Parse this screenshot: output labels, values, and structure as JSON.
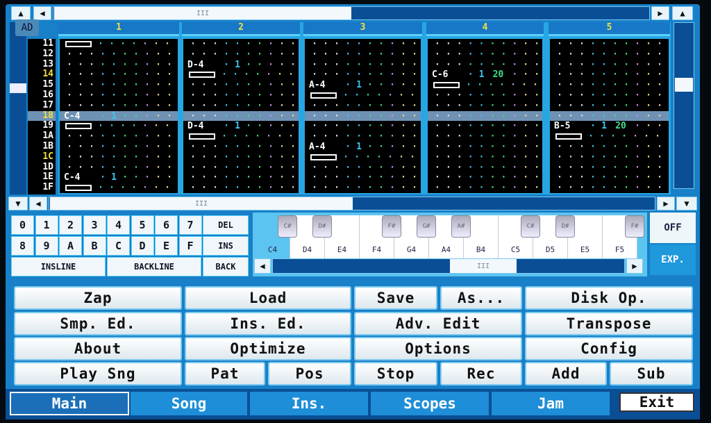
{
  "pattern": {
    "corner_label": "AD",
    "scroll_thumb": "III",
    "channels": [
      "1",
      "2",
      "3",
      "4",
      "5"
    ],
    "rows": [
      "11",
      "12",
      "13",
      "14",
      "15",
      "16",
      "17",
      "18",
      "19",
      "1A",
      "1B",
      "1C",
      "1D",
      "1E",
      "1F"
    ],
    "highlighted_rows": [
      "14",
      "18",
      "1C"
    ],
    "cursor_row": "18",
    "events": [
      [
        {
          "row": "11",
          "off": true
        },
        {
          "row": "18",
          "note": "C-4",
          "ins": "1"
        },
        {
          "row": "19",
          "off": true
        },
        {
          "row": "1E",
          "note": "C-4",
          "ins": "1"
        },
        {
          "row": "1F",
          "off": true
        }
      ],
      [
        {
          "row": "13",
          "note": "D-4",
          "ins": "1"
        },
        {
          "row": "14",
          "off": true
        },
        {
          "row": "19",
          "note": "D-4",
          "ins": "1"
        },
        {
          "row": "1A",
          "off": true
        }
      ],
      [
        {
          "row": "15",
          "note": "A-4",
          "ins": "1"
        },
        {
          "row": "16",
          "off": true
        },
        {
          "row": "1B",
          "note": "A-4",
          "ins": "1"
        },
        {
          "row": "1C",
          "off": true
        }
      ],
      [
        {
          "row": "14",
          "note": "C-6",
          "ins": "1",
          "vol": "20"
        },
        {
          "row": "15",
          "off": true
        }
      ],
      [
        {
          "row": "19",
          "note": "B-5",
          "ins": "1",
          "vol": "20"
        },
        {
          "row": "1A",
          "off": true
        }
      ]
    ]
  },
  "keypad": {
    "digits": [
      "0",
      "1",
      "2",
      "3",
      "4",
      "5",
      "6",
      "7",
      "8",
      "9",
      "A",
      "B",
      "C",
      "D",
      "E",
      "F"
    ],
    "del": "DEL",
    "ins": "INS",
    "back": "BACK",
    "insline": "INSLINE",
    "backline": "BACKLINE"
  },
  "piano": {
    "white": [
      "C4",
      "D4",
      "E4",
      "F4",
      "G4",
      "A4",
      "B4",
      "C5",
      "D5",
      "E5",
      "F5"
    ],
    "black": [
      "C#",
      "D#",
      "F#",
      "G#",
      "A#",
      "C#",
      "D#",
      "F#"
    ],
    "off": "OFF",
    "exp": "EXP.",
    "scroll_thumb": "III"
  },
  "buttons": {
    "zap": "Zap",
    "load": "Load",
    "save": "Save",
    "as": "As...",
    "disk_op": "Disk Op.",
    "smp_ed": "Smp. Ed.",
    "ins_ed": "Ins. Ed.",
    "adv_edit": "Adv. Edit",
    "transpose": "Transpose",
    "about": "About",
    "optimize": "Optimize",
    "options": "Options",
    "config": "Config",
    "play_sng": "Play Sng",
    "pat": "Pat",
    "pos": "Pos",
    "stop": "Stop",
    "rec": "Rec",
    "add": "Add",
    "sub": "Sub"
  },
  "tabs": {
    "main": "Main",
    "song": "Song",
    "ins": "Ins.",
    "scopes": "Scopes",
    "jam": "Jam",
    "exit": "Exit"
  },
  "colors": {
    "panel": "#1780c8",
    "highlight_row": "#6f92b4",
    "header_text": "#f3e040"
  }
}
